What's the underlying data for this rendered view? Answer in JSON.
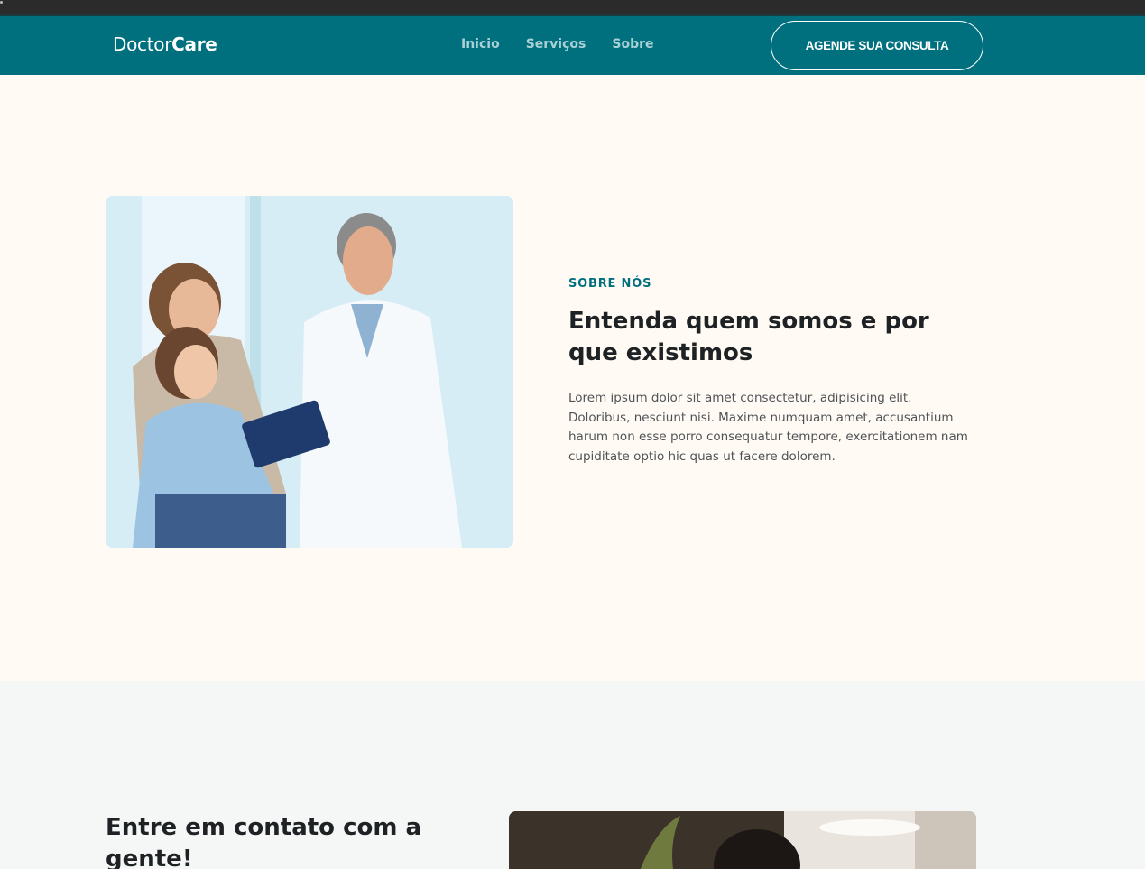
{
  "header": {
    "logo": {
      "regular": "Doctor",
      "bold": "Care"
    },
    "nav": [
      {
        "label": "Inicio"
      },
      {
        "label": "Serviços"
      },
      {
        "label": "Sobre"
      }
    ],
    "cta_label": "AGENDE SUA CONSULTA"
  },
  "about": {
    "eyebrow": "SOBRE NÓS",
    "title": "Entenda quem somos e por que existimos",
    "description": "Lorem ipsum dolor sit amet consectetur, adipisicing elit. Doloribus, nesciunt nisi. Maxime numquam amet, accusantium harum non esse porro consequatur tempore, exercitationem nam cupiditate optio hic quas ut facere dolorem."
  },
  "contact": {
    "title": "Entre em contato com a gente!"
  },
  "colors": {
    "brand": "#00707f",
    "page_background": "#fffaf3",
    "section_alt_background": "#f5f7f6",
    "heading_text": "#1f2225",
    "body_text": "#4f5358"
  }
}
